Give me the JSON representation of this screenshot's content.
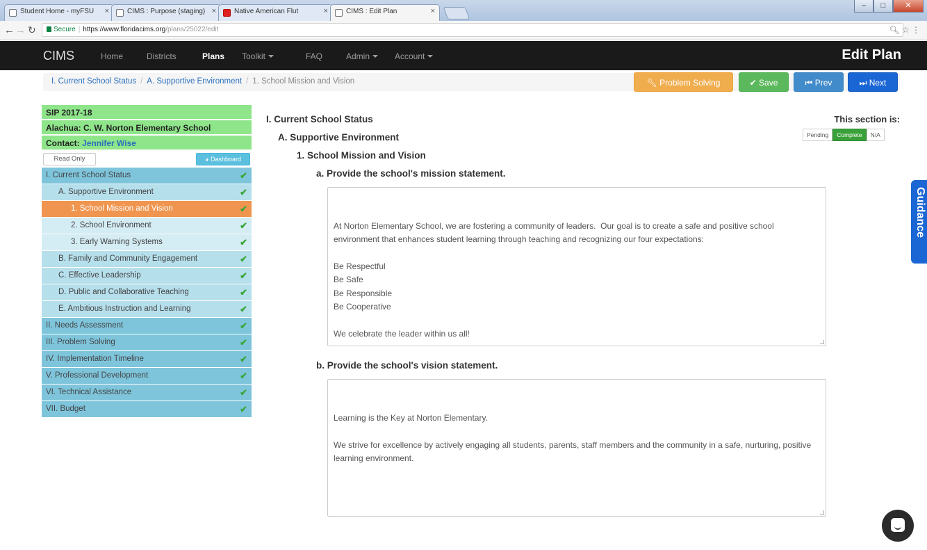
{
  "browser": {
    "tabs": [
      {
        "title": "Student Home - myFSU"
      },
      {
        "title": "CIMS : Purpose (staging)"
      },
      {
        "title": "Native American Flut"
      },
      {
        "title": "CIMS : Edit Plan"
      }
    ],
    "secure_label": "Secure",
    "url_host": "https://www.floridacims.org",
    "url_path": "/plans/25022/edit"
  },
  "navbar": {
    "brand": "CIMS",
    "items": [
      "Home",
      "Districts",
      "Plans",
      "Toolkit",
      "FAQ",
      "Admin",
      "Account"
    ],
    "page_title": "Edit Plan"
  },
  "breadcrumb": {
    "crumb1": "I. Current School Status",
    "crumb2": "A. Supportive Environment",
    "current": "1. School Mission and Vision"
  },
  "actions": {
    "problem_solving": "Problem Solving",
    "save": "Save",
    "prev": "Prev",
    "next": "Next"
  },
  "sidebar": {
    "plan": "SIP 2017-18",
    "school": "Alachua: C. W. Norton Elementary School",
    "contact_label": "Contact:",
    "contact_name": "Jennifer Wise",
    "read_only": "Read Only",
    "dashboard": "Dashboard",
    "items": [
      {
        "label": "I.   Current School Status"
      },
      {
        "label": "A. Supportive Environment"
      },
      {
        "label": "1. School Mission and Vision"
      },
      {
        "label": "2. School Environment"
      },
      {
        "label": "3. Early Warning Systems"
      },
      {
        "label": "B. Family and Community Engagement"
      },
      {
        "label": "C. Effective Leadership"
      },
      {
        "label": "D. Public and Collaborative Teaching"
      },
      {
        "label": "E. Ambitious Instruction and Learning"
      },
      {
        "label": "II. Needs Assessment"
      },
      {
        "label": "III. Problem Solving"
      },
      {
        "label": "IV. Implementation Timeline"
      },
      {
        "label": "V. Professional Development"
      },
      {
        "label": "VI. Technical Assistance"
      },
      {
        "label": "VII. Budget"
      }
    ]
  },
  "content": {
    "section": "I. Current School Status",
    "subsection": "A. Supportive Environment",
    "topic": "1. School Mission and Vision",
    "q_a": "a. Provide the school's mission statement.",
    "answer_a": "At Norton Elementary School, we are fostering a community of leaders.  Our goal is to create a safe and positive school environment that enhances student learning through teaching and recognizing our four expectations:\n\nBe Respectful\nBe Safe\nBe Responsible\nBe Cooperative\n\nWe celebrate the leader within us all!",
    "q_b": "b. Provide the school's vision statement.",
    "answer_b": "Learning is the Key at Norton Elementary.\n\nWe strive for excellence by actively engaging all students, parents, staff members and the community in a safe, nurturing, positive learning environment."
  },
  "status": {
    "title": "This section is:",
    "options": [
      "Pending",
      "Complete",
      "N/A"
    ],
    "selected": "Complete"
  },
  "guidance": {
    "label": "Guidance"
  },
  "colors": {
    "navbar": "#1a1a1a",
    "problem_solving": "#f0ad4e",
    "save": "#5cb85c",
    "prev": "#428bca",
    "next": "#1a66d4",
    "current_item": "#f0954f",
    "header_green": "#8fe58a"
  }
}
